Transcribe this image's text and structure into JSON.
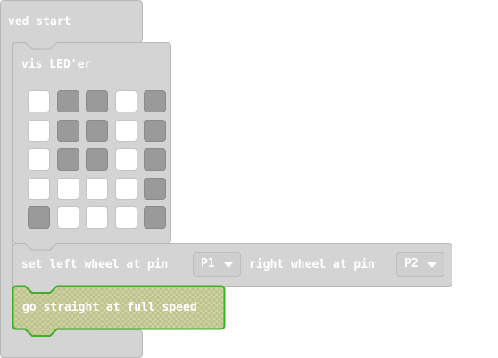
{
  "blocks": {
    "on_start": {
      "label": "ved start"
    },
    "show_leds": {
      "label": "vis LED'er",
      "grid": [
        [
          1,
          0,
          0,
          1,
          0
        ],
        [
          1,
          0,
          0,
          1,
          0
        ],
        [
          1,
          0,
          0,
          1,
          0
        ],
        [
          1,
          1,
          1,
          1,
          0
        ],
        [
          0,
          1,
          1,
          1,
          0
        ]
      ]
    },
    "set_wheels": {
      "label_left": "set left wheel at pin",
      "left_pin": "P1",
      "label_right": "right wheel at pin",
      "right_pin": "P2"
    },
    "go_straight": {
      "label": "go straight at full speed"
    }
  },
  "colors": {
    "block_fill": "#d4d4d4",
    "block_stroke": "#b8b8b8",
    "led_on": "#ffffff",
    "led_off": "#9a9a9a",
    "selected_fill": "#c8cc9c",
    "selected_stroke": "#3fae2a",
    "text": "#ffffff"
  }
}
